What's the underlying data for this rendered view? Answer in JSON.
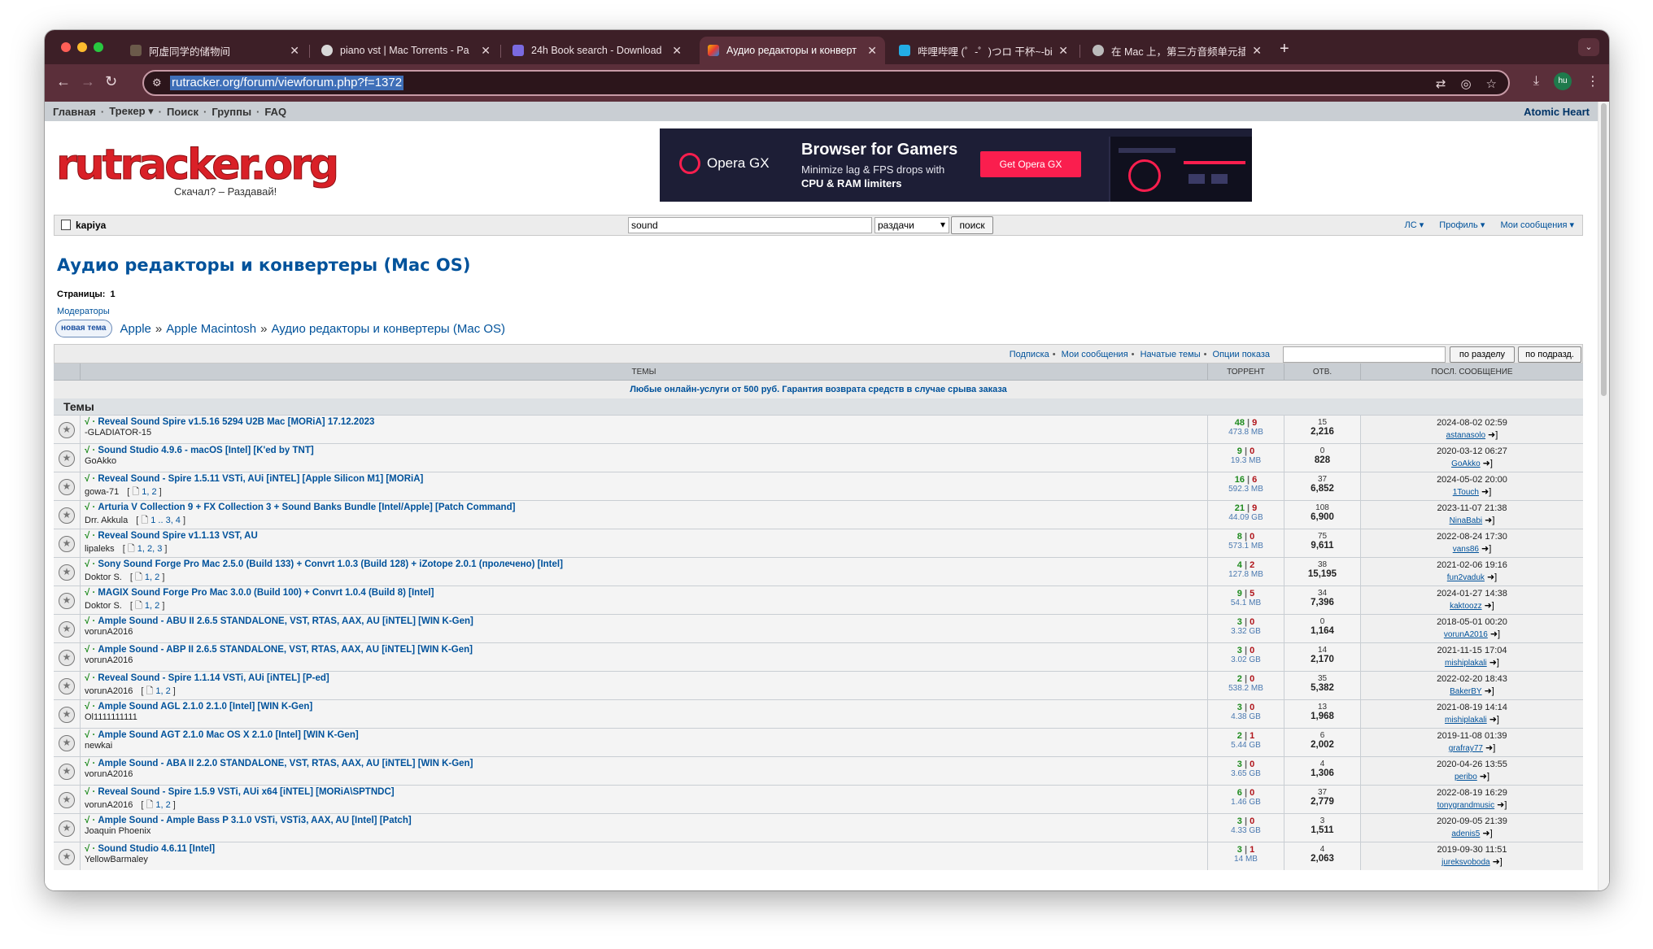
{
  "browser": {
    "tabs": [
      {
        "title": "阿虚同学的储物间",
        "active": false
      },
      {
        "title": "piano vst | Mac Torrents - Pa",
        "active": false
      },
      {
        "title": "24h Book search - Download",
        "active": false
      },
      {
        "title": "Аудио редакторы и конверт",
        "active": true
      },
      {
        "title": "哔哩哔哩 (゜-゜)つロ 干杯~-bi",
        "active": false
      },
      {
        "title": "在 Mac 上，第三方音频单元插",
        "active": false
      }
    ],
    "url": "rutracker.org/forum/viewforum.php?f=1372",
    "profile_initials": "hu"
  },
  "topnav": {
    "items": [
      "Главная",
      "Трекер",
      "Поиск",
      "Группы",
      "FAQ"
    ],
    "right_link": "Atomic Heart"
  },
  "logo": {
    "text": "rutracker.org",
    "slogan": "Скачал? – Раздавай!"
  },
  "banner": {
    "brand": "Opera GX",
    "title": "Browser for Gamers",
    "subtitle": "Minimize lag & FPS drops with",
    "subtitle_bold": "CPU & RAM limiters",
    "cta": "Get Opera GX"
  },
  "loginbar": {
    "username": "kapiya",
    "search_value": "sound",
    "search_scope": "раздачи",
    "search_button": "поиск",
    "links": [
      "ЛС",
      "Профиль",
      "Мои сообщения"
    ]
  },
  "forum": {
    "title": "Аудио редакторы и конвертеры (Mac OS)",
    "pages_label": "Страницы:",
    "pages_value": "1",
    "moderators": "Модераторы",
    "new_topic": "новая тема",
    "breadcrumb": [
      "Apple",
      "Apple Macintosh",
      "Аудио редакторы и конвертеры (Mac OS)"
    ]
  },
  "toolrow": {
    "links": [
      "Подписка",
      "Мои сообщения",
      "Начатые темы",
      "Опции показа"
    ],
    "btn_section": "по разделу",
    "btn_subsection": "по подразд."
  },
  "table": {
    "headers": {
      "topics": "ТЕМЫ",
      "torrent": "ТОРРЕНТ",
      "replies": "ОТВ.",
      "last": "ПОСЛ. СООБЩЕНИЕ"
    },
    "ad": "Любые онлайн-услуги от 500 руб. Гарантия возврата средств в случае срыва заказа",
    "section": "Темы",
    "rows": [
      {
        "title": "Reveal Sound Spire v1.5.16 5294 U2B Mac [MORiA] 17.12.2023",
        "author": "-GLADIATOR-15",
        "pages": "",
        "seeds": "48",
        "leech": "9",
        "size": "473.8 MB",
        "replies": "15",
        "views": "2,216",
        "date": "2024-08-02 02:59",
        "last_user": "astanasolo"
      },
      {
        "title": "Sound Studio 4.9.6 - macOS [Intel] [K'ed by TNT]",
        "author": "GoAkko",
        "pages": "",
        "seeds": "9",
        "leech": "0",
        "size": "19.3 MB",
        "replies": "0",
        "views": "828",
        "date": "2020-03-12 06:27",
        "last_user": "GoAkko"
      },
      {
        "title": "Reveal Sound - Spire 1.5.11 VSTi, AUi [iNTEL] [Apple Silicon M1] [MORiA]",
        "author": "gowa-71",
        "pages": "1, 2",
        "seeds": "16",
        "leech": "6",
        "size": "592.3 MB",
        "replies": "37",
        "views": "6,852",
        "date": "2024-05-02 20:00",
        "last_user": "1Touch"
      },
      {
        "title": "Arturia V Collection 9 + FX Collection 3 + Sound Banks Bundle [Intel/Apple] [Patch Command]",
        "author": "Drr. Akkula",
        "pages": "1 .. 3, 4",
        "seeds": "21",
        "leech": "9",
        "size": "44.09 GB",
        "replies": "108",
        "views": "6,900",
        "date": "2023-11-07 21:38",
        "last_user": "NinaBabi"
      },
      {
        "title": "Reveal Sound Spire v1.1.13 VST, AU",
        "author": "lipaleks",
        "pages": "1, 2, 3",
        "seeds": "8",
        "leech": "0",
        "size": "573.1 MB",
        "replies": "75",
        "views": "9,611",
        "date": "2022-08-24 17:30",
        "last_user": "vans86"
      },
      {
        "title": "Sony Sound Forge Pro Mac 2.5.0 (Build 133) + Convrt 1.0.3 (Build 128) + iZotope 2.0.1 (пролечено) [Intel]",
        "author": "Doktor S.",
        "pages": "1, 2",
        "seeds": "4",
        "leech": "2",
        "size": "127.8 MB",
        "replies": "38",
        "views": "15,195",
        "date": "2021-02-06 19:16",
        "last_user": "fun2vaduk"
      },
      {
        "title": "MAGIX Sound Forge Pro Mac 3.0.0 (Build 100) + Convrt 1.0.4 (Build 8) [Intel]",
        "author": "Doktor S.",
        "pages": "1, 2",
        "seeds": "9",
        "leech": "5",
        "size": "54.1 MB",
        "replies": "34",
        "views": "7,396",
        "date": "2024-01-27 14:38",
        "last_user": "kaktoozz"
      },
      {
        "title": "Ample Sound - ABU II 2.6.5 STANDALONE, VST, RTAS, AAX, AU [iNTEL] [WIN K-Gen]",
        "author": "vorunA2016",
        "pages": "",
        "seeds": "3",
        "leech": "0",
        "size": "3.32 GB",
        "replies": "0",
        "views": "1,164",
        "date": "2018-05-01 00:20",
        "last_user": "vorunA2016"
      },
      {
        "title": "Ample Sound - ABP II 2.6.5 STANDALONE, VST, RTAS, AAX, AU [iNTEL] [WIN K-Gen]",
        "author": "vorunA2016",
        "pages": "",
        "seeds": "3",
        "leech": "0",
        "size": "3.02 GB",
        "replies": "14",
        "views": "2,170",
        "date": "2021-11-15 17:04",
        "last_user": "mishiplakali"
      },
      {
        "title": "Reveal Sound - Spire 1.1.14 VSTi, AUi [iNTEL] [P-ed]",
        "author": "vorunA2016",
        "pages": "1, 2",
        "seeds": "2",
        "leech": "0",
        "size": "538.2 MB",
        "replies": "35",
        "views": "5,382",
        "date": "2022-02-20 18:43",
        "last_user": "BakerBY"
      },
      {
        "title": "Ample Sound AGL 2.1.0 2.1.0 [Intel] [WIN K-Gen]",
        "author": "Ol1111111111",
        "pages": "",
        "seeds": "3",
        "leech": "0",
        "size": "4.38 GB",
        "replies": "13",
        "views": "1,968",
        "date": "2021-08-19 14:14",
        "last_user": "mishiplakali"
      },
      {
        "title": "Ample Sound AGT 2.1.0 Mac OS X 2.1.0 [Intel] [WIN K-Gen]",
        "author": "newkai",
        "pages": "",
        "seeds": "2",
        "leech": "1",
        "size": "5.44 GB",
        "replies": "6",
        "views": "2,002",
        "date": "2019-11-08 01:39",
        "last_user": "grafray77"
      },
      {
        "title": "Ample Sound - ABA II 2.2.0 STANDALONE, VST, RTAS, AAX, AU [iNTEL] [WIN K-Gen]",
        "author": "vorunA2016",
        "pages": "",
        "seeds": "3",
        "leech": "0",
        "size": "3.65 GB",
        "replies": "4",
        "views": "1,306",
        "date": "2020-04-26 13:55",
        "last_user": "peribo"
      },
      {
        "title": "Reveal Sound - Spire 1.5.9 VSTi, AUi x64 [iNTEL] [MORiA\\SPTNDC]",
        "author": "vorunA2016",
        "pages": "1, 2",
        "seeds": "6",
        "leech": "0",
        "size": "1.46 GB",
        "replies": "37",
        "views": "2,779",
        "date": "2022-08-19 16:29",
        "last_user": "tonygrandmusic"
      },
      {
        "title": "Ample Sound - Ample Bass P 3.1.0 VSTi, VSTi3, AAX, AU [Intel] [Patch]",
        "author": "Joaquin Phoenix",
        "pages": "",
        "seeds": "3",
        "leech": "0",
        "size": "4.33 GB",
        "replies": "3",
        "views": "1,511",
        "date": "2020-09-05 21:39",
        "last_user": "adenis5"
      },
      {
        "title": "Sound Studio 4.6.11 [Intel]",
        "author": "YellowBarmaley",
        "pages": "",
        "seeds": "3",
        "leech": "1",
        "size": "14 MB",
        "replies": "4",
        "views": "2,063",
        "date": "2019-09-30 11:51",
        "last_user": "jureksvoboda"
      }
    ]
  }
}
